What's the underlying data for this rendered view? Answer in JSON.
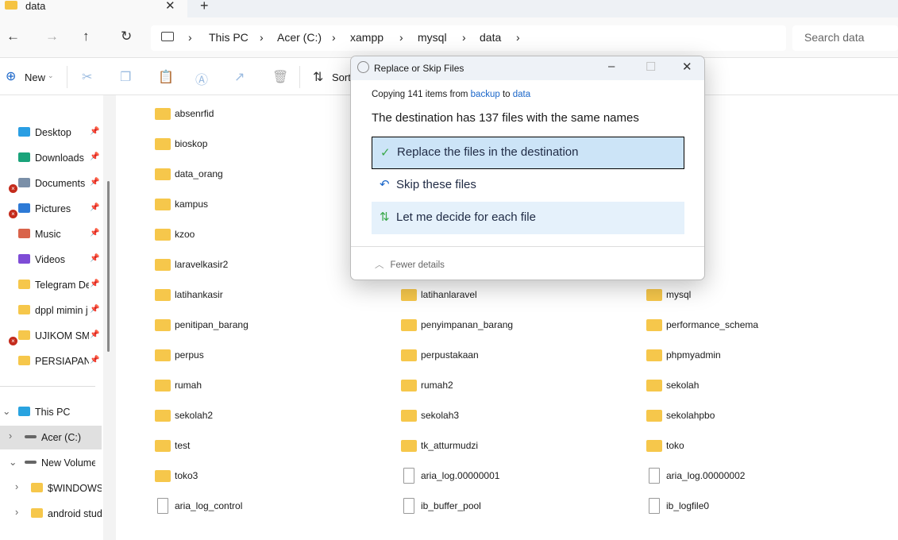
{
  "tab": {
    "title": "data",
    "close": "✕",
    "new_tab": "+"
  },
  "nav": {
    "back": "←",
    "forward": "→",
    "up": "↑",
    "refresh": "↻"
  },
  "breadcrumb": [
    "This PC",
    "Acer (C:)",
    "xampp",
    "mysql",
    "data"
  ],
  "search": {
    "placeholder": "Search data"
  },
  "toolbar": {
    "new_label": "New",
    "sort_label": "Sort"
  },
  "sidebar": {
    "quick": [
      {
        "label": "Desktop",
        "color": "#2a9ee3",
        "error": false
      },
      {
        "label": "Downloads",
        "color": "#1aa37a",
        "error": false
      },
      {
        "label": "Documents",
        "color": "#7a8fa8",
        "error": true
      },
      {
        "label": "Pictures",
        "color": "#2d7ad6",
        "error": true
      },
      {
        "label": "Music",
        "color": "#d9634a",
        "error": false
      },
      {
        "label": "Videos",
        "color": "#7e4cd6",
        "error": false
      },
      {
        "label": "Telegram Des",
        "color": "#f6c74b",
        "error": false
      },
      {
        "label": "dppl mimin j",
        "color": "#f6c74b",
        "error": false
      },
      {
        "label": "UJIKOM SMT",
        "color": "#f6c74b",
        "error": true
      },
      {
        "label": "PERSIAPAN U",
        "color": "#f6c74b",
        "error": false
      }
    ],
    "tree": [
      {
        "label": "This PC",
        "chevron": "⌄",
        "indent": 0
      },
      {
        "label": "Acer (C:)",
        "chevron": "›",
        "indent": 1
      },
      {
        "label": "New Volume (I",
        "chevron": "⌄",
        "indent": 1
      },
      {
        "label": "$WINDOWS.~",
        "chevron": "›",
        "indent": 2
      },
      {
        "label": "android stud",
        "chevron": "›",
        "indent": 2
      }
    ]
  },
  "files": {
    "col1": [
      {
        "name": "absenrfid",
        "type": "folder"
      },
      {
        "name": "bioskop",
        "type": "folder"
      },
      {
        "name": "data_orang",
        "type": "folder"
      },
      {
        "name": "kampus",
        "type": "folder"
      },
      {
        "name": "kzoo",
        "type": "folder"
      },
      {
        "name": "laravelkasir2",
        "type": "folder"
      },
      {
        "name": "latihankasir",
        "type": "folder"
      },
      {
        "name": "penitipan_barang",
        "type": "folder"
      },
      {
        "name": "perpus",
        "type": "folder"
      },
      {
        "name": "rumah",
        "type": "folder"
      },
      {
        "name": "sekolah2",
        "type": "folder"
      },
      {
        "name": "test",
        "type": "folder"
      },
      {
        "name": "toko3",
        "type": "folder"
      },
      {
        "name": "aria_log_control",
        "type": "file"
      }
    ],
    "col2": [
      {
        "name": "latihanlaravel",
        "type": "folder"
      },
      {
        "name": "penyimpanan_barang",
        "type": "folder"
      },
      {
        "name": "perpustakaan",
        "type": "folder"
      },
      {
        "name": "rumah2",
        "type": "folder"
      },
      {
        "name": "sekolah3",
        "type": "folder"
      },
      {
        "name": "tk_atturmudzi",
        "type": "folder"
      },
      {
        "name": "aria_log.00000001",
        "type": "file"
      },
      {
        "name": "ib_buffer_pool",
        "type": "file"
      }
    ],
    "col3": [
      {
        "name": "mysql",
        "type": "folder"
      },
      {
        "name": "performance_schema",
        "type": "folder"
      },
      {
        "name": "phpmyadmin",
        "type": "folder"
      },
      {
        "name": "sekolah",
        "type": "folder"
      },
      {
        "name": "sekolahpbo",
        "type": "folder"
      },
      {
        "name": "toko",
        "type": "folder"
      },
      {
        "name": "aria_log.00000002",
        "type": "file"
      },
      {
        "name": "ib_logfile0",
        "type": "file"
      }
    ]
  },
  "dialog": {
    "title": "Replace or Skip Files",
    "copy_prefix": "Copying 141 items from",
    "source": "backup",
    "to": "to",
    "destination": "data",
    "message": "The destination has 137 files with the same names",
    "options": [
      "Replace the files in the destination",
      "Skip these files",
      "Let me decide for each file"
    ],
    "fewer_details": "Fewer details",
    "selected_option": 0
  }
}
